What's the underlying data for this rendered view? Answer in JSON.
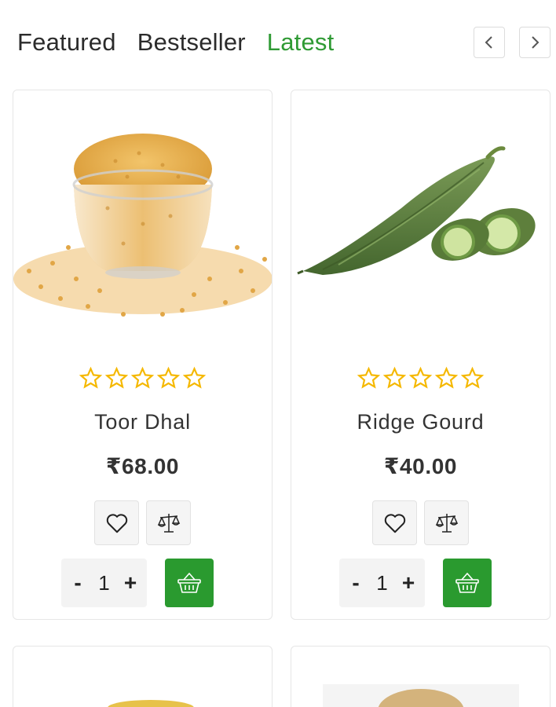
{
  "tabs": {
    "featured": "Featured",
    "bestseller": "Bestseller",
    "latest": "Latest",
    "active": "latest"
  },
  "colors": {
    "accent": "#2f9a34",
    "cart_button": "#2a9a2f",
    "star": "#f5b800"
  },
  "products": [
    {
      "name": "Toor Dhal",
      "price": "₹68.00",
      "rating": 0,
      "quantity": "1",
      "image": "toor-dhal-image"
    },
    {
      "name": "Ridge Gourd",
      "price": "₹40.00",
      "rating": 0,
      "quantity": "1",
      "image": "ridge-gourd-image"
    }
  ],
  "controls": {
    "qty_minus": "-",
    "qty_plus": "+",
    "prev_icon": "chevron-left-icon",
    "next_icon": "chevron-right-icon",
    "wishlist_icon": "heart-icon",
    "compare_icon": "scale-icon",
    "cart_icon": "basket-icon"
  }
}
